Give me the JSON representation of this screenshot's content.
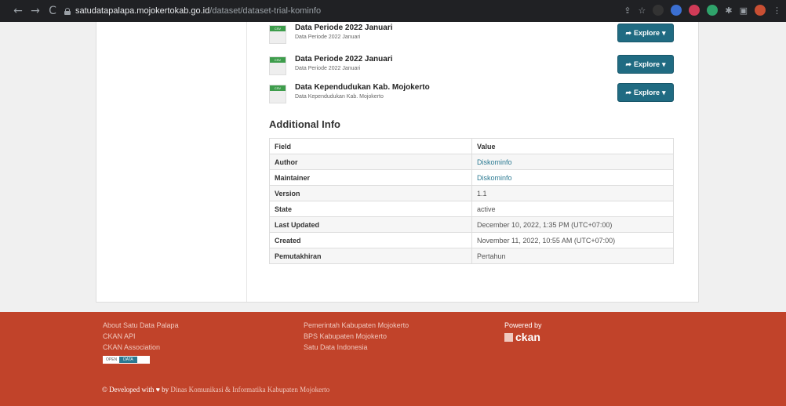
{
  "browser": {
    "url_host": "satudatapalapa.mojokertokab.go.id",
    "url_path": "/dataset/dataset-trial-kominfo"
  },
  "resources": [
    {
      "title": "Data Periode 2022 Januari",
      "description": "Data Periode 2022 Januari",
      "format": "CSV",
      "button": "Explore"
    },
    {
      "title": "Data Periode 2022 Januari",
      "description": "Data Periode 2022 Januari",
      "format": "CSV",
      "button": "Explore"
    },
    {
      "title": "Data Kependudukan Kab. Mojokerto",
      "description": "Data Kependudukan Kab. Mojokerto",
      "format": "CSV",
      "button": "Explore"
    }
  ],
  "additional_info": {
    "heading": "Additional Info",
    "col_field": "Field",
    "col_value": "Value",
    "rows": [
      {
        "field": "Author",
        "value": "Diskominfo"
      },
      {
        "field": "Maintainer",
        "value": "Diskominfo"
      },
      {
        "field": "Version",
        "value": "1.1"
      },
      {
        "field": "State",
        "value": "active"
      },
      {
        "field": "Last Updated",
        "value": "December 10, 2022, 1:35 PM (UTC+07:00)"
      },
      {
        "field": "Created",
        "value": "November 11, 2022, 10:55 AM (UTC+07:00)"
      },
      {
        "field": "Pemutakhiran",
        "value": "Pertahun"
      }
    ]
  },
  "footer": {
    "col1": [
      "About Satu Data Palapa",
      "CKAN API",
      "CKAN Association"
    ],
    "open_data_badge": [
      "OPEN",
      "DATA"
    ],
    "col2": [
      "Pemerintah Kabupaten Mojokerto",
      "BPS Kabupaten Mojokerto",
      "Satu Data Indonesia"
    ],
    "powered_by": "Powered by",
    "ckan_logo": "ckan",
    "dev_prefix": "© Developed with",
    "dev_by": "by",
    "dev_org": "Dinas Komunikasi & Informatika Kabupaten Mojokerto"
  },
  "colors": {
    "footer_bg": "#c1432a",
    "button": "#206b82",
    "link": "#2b7a92"
  }
}
